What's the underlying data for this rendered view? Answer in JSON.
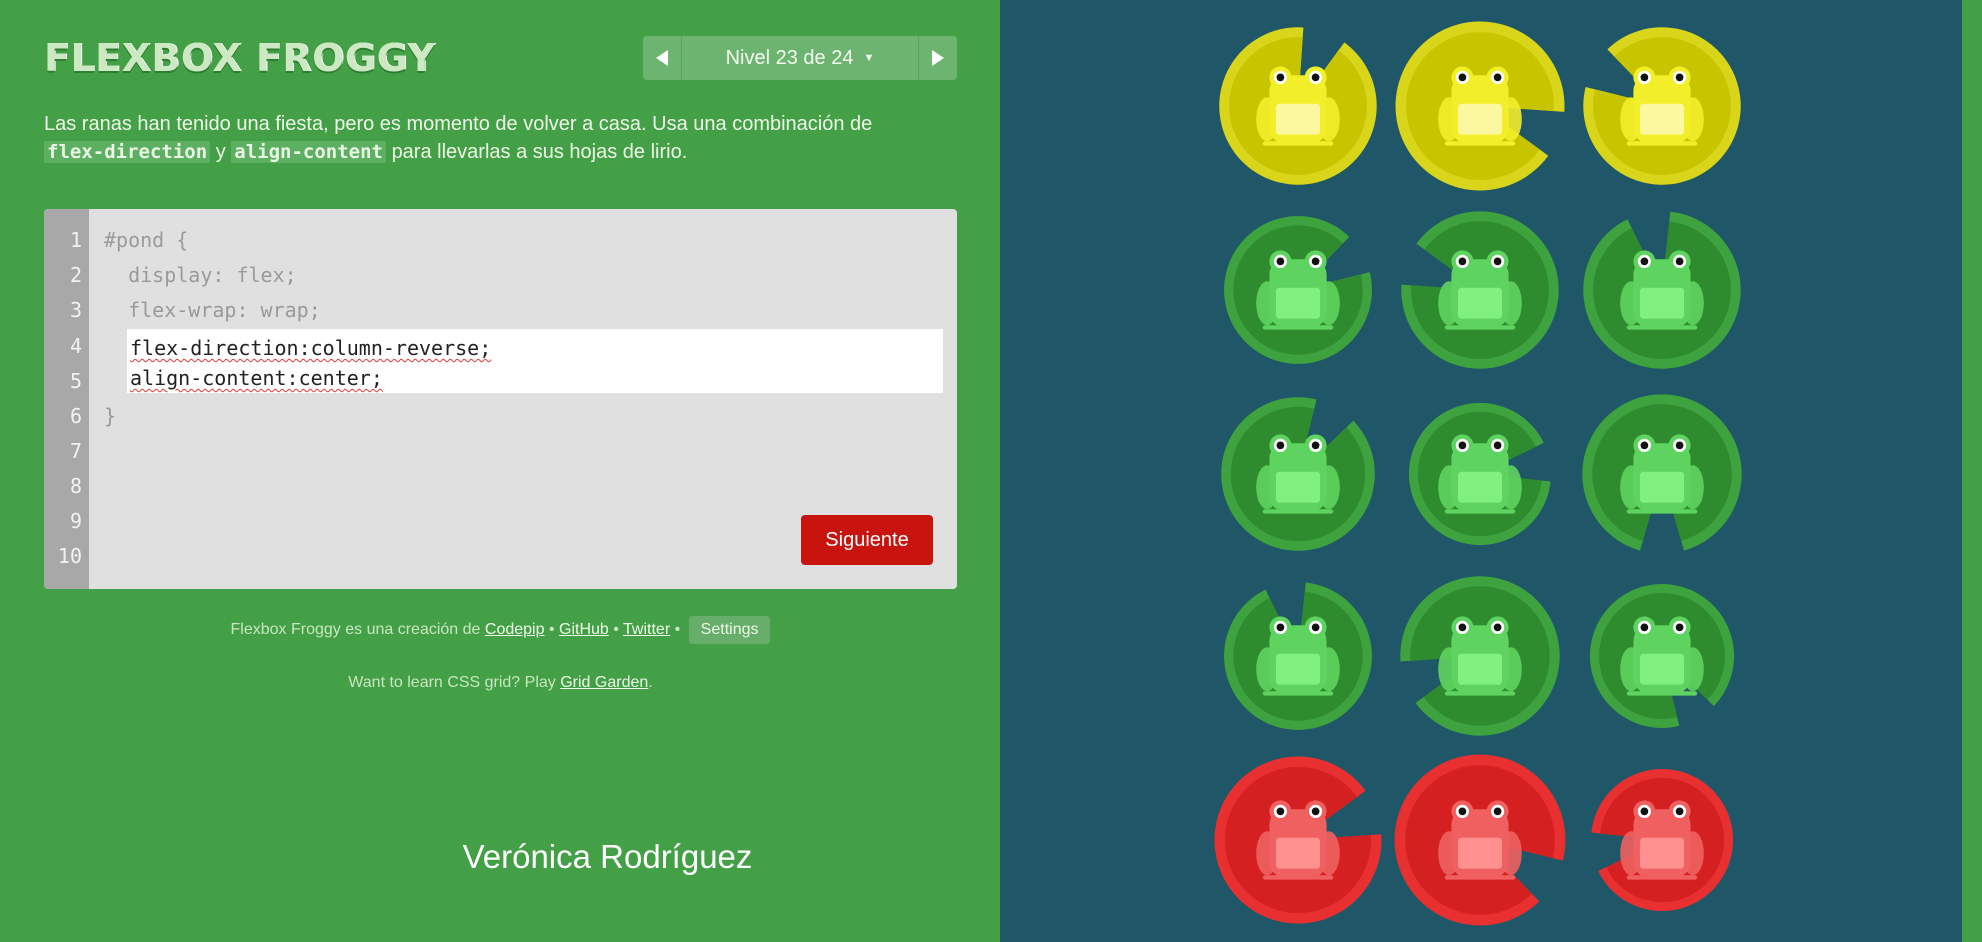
{
  "app": {
    "title": "FLEXBOX FROGGY",
    "level_label": "Nivel 23 de 24",
    "prev_icon": "triangle-left-icon",
    "next_icon": "triangle-right-icon",
    "dropdown_icon": "caret-down-icon"
  },
  "instructions": {
    "part1": "Las ranas han tenido una fiesta, pero es momento de volver a casa. Usa una combinación de",
    "kw1": "flex-direction",
    "part2": "y",
    "kw2": "align-content",
    "part3": "para llevarlas a sus hojas de lirio."
  },
  "editor": {
    "line_numbers": [
      "1",
      "2",
      "3",
      "4",
      "5",
      "6",
      "7",
      "8",
      "9",
      "10"
    ],
    "line1": "#pond {",
    "line2": "  display: flex;",
    "line3": "  flex-wrap: wrap;",
    "input1": "flex-direction:column-reverse;",
    "input2": "align-content:center;",
    "line6": "}",
    "next_label": "Siguiente"
  },
  "footer": {
    "credit_prefix": "Flexbox Froggy es una creación de",
    "codepip": "Codepip",
    "github": "GitHub",
    "twitter": "Twitter",
    "sep": "•",
    "settings": "Settings",
    "promo_prefix": "Want to learn CSS grid? Play",
    "grid_garden": "Grid Garden",
    "promo_suffix": "."
  },
  "author": "Verónica Rodríguez",
  "colors": {
    "yellow_pad": "#c9c400",
    "yellow_frog": "#f2ee2a",
    "green_pad": "#2e8b2e",
    "green_frog": "#5fd35f",
    "red_pad": "#d42020",
    "red_frog": "#f06060",
    "pond": "#1f5768"
  },
  "pond": {
    "rows": [
      [
        "yellow",
        "yellow",
        "yellow"
      ],
      [
        "green",
        "green",
        "green"
      ],
      [
        "green",
        "green",
        "green"
      ],
      [
        "green",
        "green",
        "green"
      ],
      [
        "red",
        "red",
        "red"
      ]
    ]
  }
}
